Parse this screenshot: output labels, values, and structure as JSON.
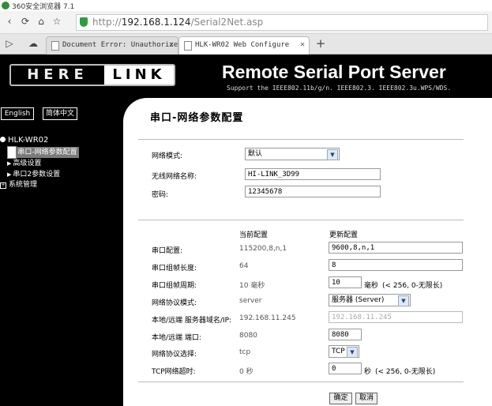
{
  "browser": {
    "title": "360安全浏览器 7.1",
    "url_prefix": "http://",
    "url_host": "192.168.1.124",
    "url_path": "/Serial2Net.asp",
    "tabs": [
      {
        "label": "Document Error: Unauthorize"
      },
      {
        "label": "HLK-WR02 Web Configure"
      }
    ]
  },
  "header": {
    "logo_left": "HERE",
    "logo_right": "LINK",
    "product_title": "Remote Serial Port Server",
    "support_text": "Support the IEEE802.11b/g/n. IEEE802.3. IEEE802.3u.WPS/WDS."
  },
  "sidebar": {
    "lang_en": "English",
    "lang_cn": "简体中文",
    "root": "HLK-WR02",
    "items": [
      {
        "label": "串口-网络参数配置",
        "selected": true
      },
      {
        "label": "高级设置"
      },
      {
        "label": "串口2参数设置"
      },
      {
        "label": "系统管理"
      }
    ]
  },
  "main": {
    "title": "串口-网络参数配置",
    "network": {
      "mode_label": "网络模式:",
      "mode_value": "默认",
      "ssid_label": "无线网络名称:",
      "ssid_value": "HI-LINK_3D99",
      "password_label": "密码:",
      "password_value": "12345678"
    },
    "columns": {
      "current": "当前配置",
      "update": "更新配置"
    },
    "rows": {
      "serial": {
        "label": "串口配置:",
        "current": "115200,8,n,1",
        "update": "9600,8,n,1"
      },
      "frame_len": {
        "label": "串口组帧长度:",
        "current": "64",
        "update": "8"
      },
      "frame_period": {
        "label": "串口组帧周期:",
        "current": "10 毫秒",
        "update": "10",
        "unit": "毫秒",
        "hint": "(< 256, 0-无限长)"
      },
      "proto_mode": {
        "label": "网络协议模式:",
        "current": "server",
        "update": "服务器 (Server)"
      },
      "remote_ip": {
        "label": "本地/远端 服务器域名/IP:",
        "current": "192.168.11.245",
        "update": "192.168.11.245"
      },
      "port": {
        "label": "本地/远端 端口:",
        "current": "8080",
        "update": "8080"
      },
      "protocol": {
        "label": "网络协议选择:",
        "current": "tcp",
        "update": "TCP"
      },
      "timeout": {
        "label": "TCP网络超时:",
        "current": "0 秒",
        "update": "0",
        "unit": "秒",
        "hint": "(< 256, 0-无限长)"
      }
    },
    "buttons": {
      "ok": "确定",
      "cancel": "取消"
    }
  }
}
